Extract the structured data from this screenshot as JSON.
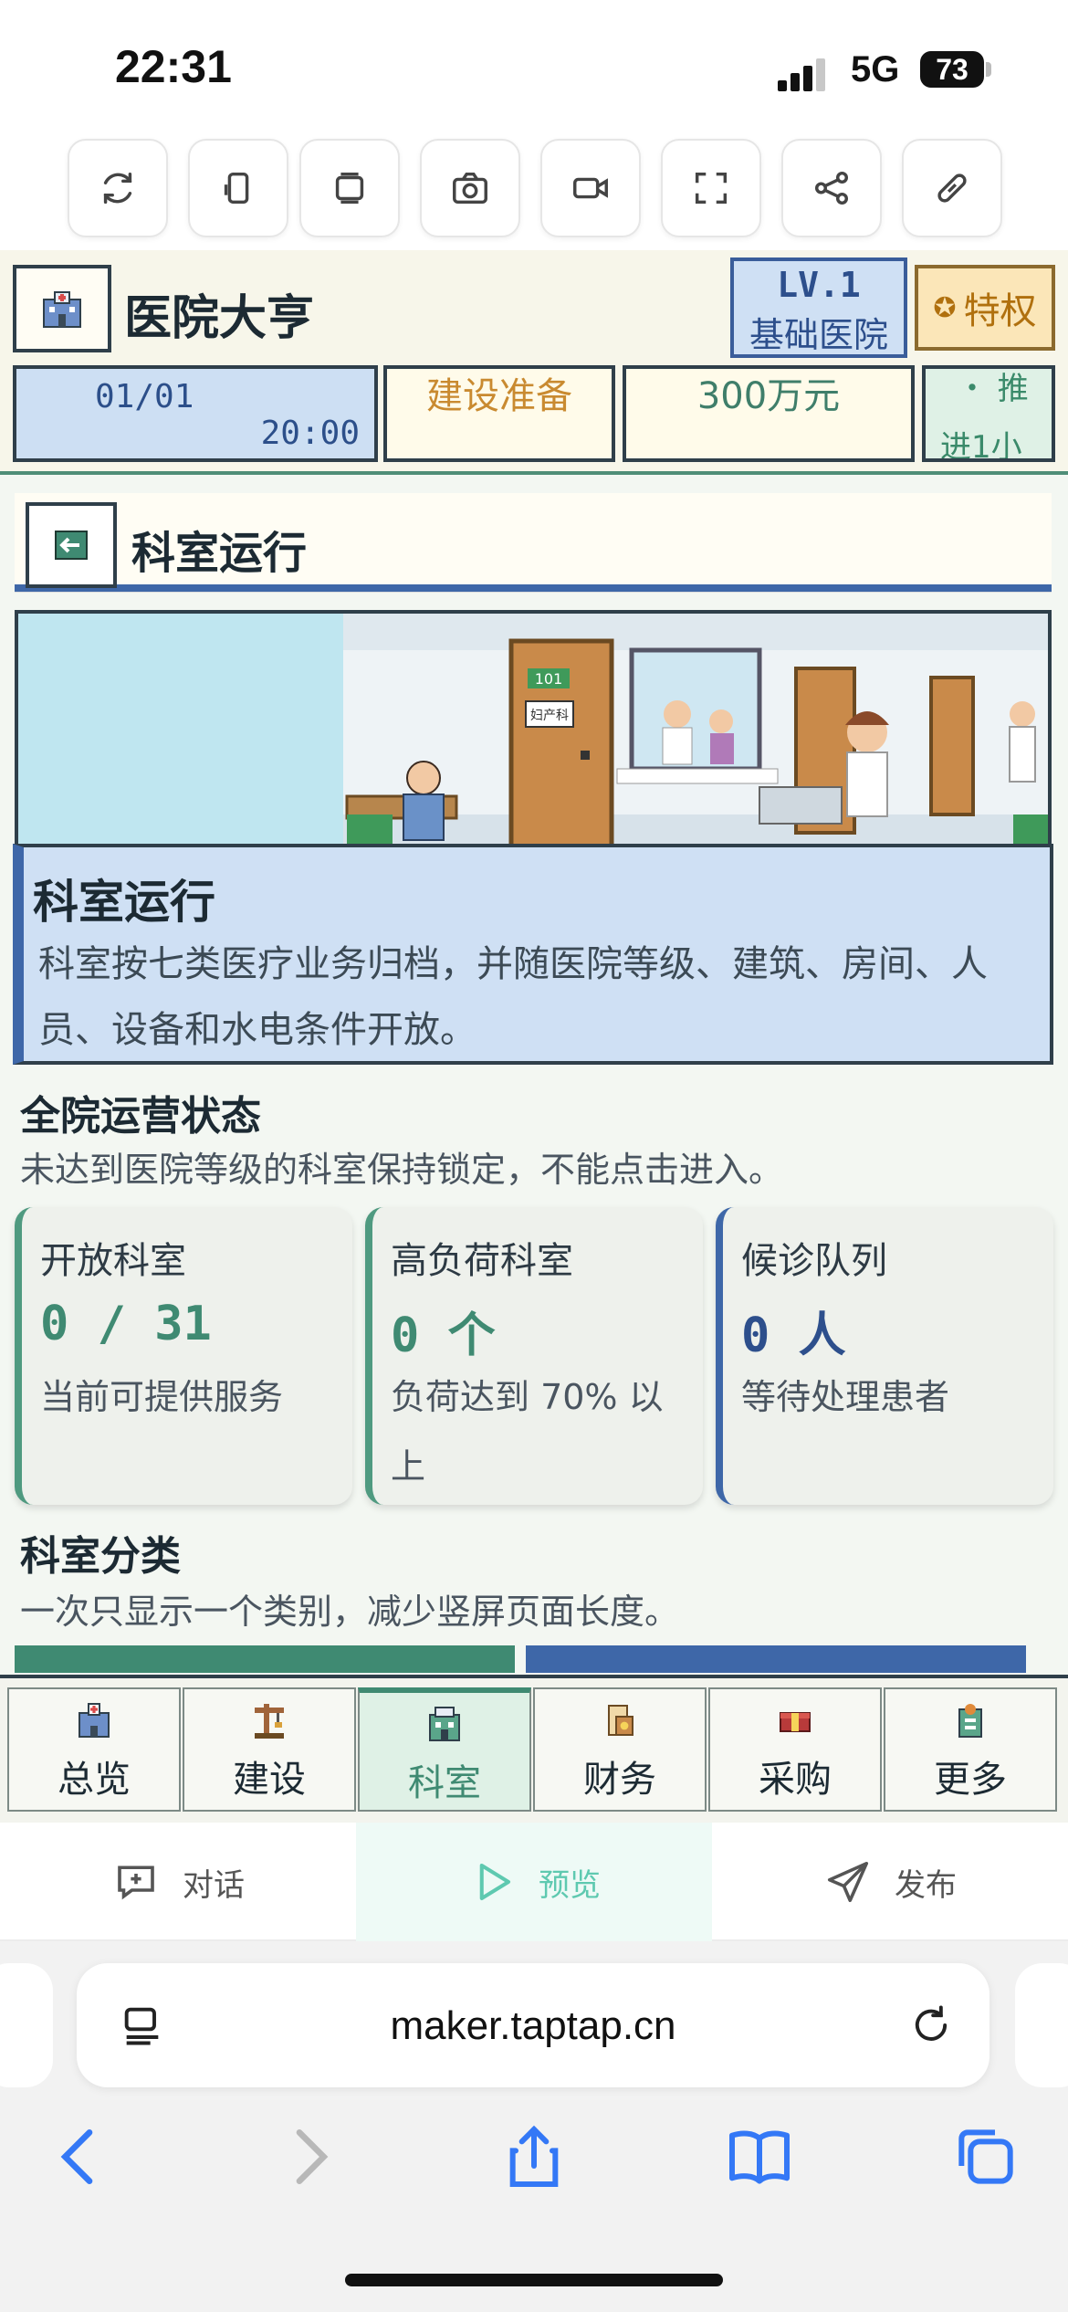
{
  "status_bar": {
    "time": "22:31",
    "network": "5G",
    "battery": "73"
  },
  "toolbar": {
    "icons": [
      "refresh-icon",
      "rotate-icon",
      "copy-icon",
      "screenshot-icon",
      "record-icon",
      "fullscreen-icon",
      "share-icon",
      "link-icon"
    ]
  },
  "game": {
    "header": {
      "title": "医院大亨",
      "level": "LV.1",
      "level_name": "基础医院",
      "privilege": "特权",
      "date": "01/01",
      "time": "20:00",
      "phase": "建设准备",
      "money": "300万元",
      "tip_line1": "・ 推",
      "tip_line2": "进1小"
    },
    "section": {
      "title": "科室运行"
    },
    "banner": {
      "door_label_101": "101",
      "door_label_obstetrics": "妇产科",
      "title": "科室运行",
      "description": "科室按七类医疗业务归档，并随医院等级、建筑、房间、人员、设备和水电条件开放。"
    },
    "overview": {
      "heading": "全院运营状态",
      "subtitle": "未达到医院等级的科室保持锁定，不能点击进入。",
      "cards": [
        {
          "label": "开放科室",
          "value": "0 / 31",
          "note": "当前可提供服务"
        },
        {
          "label": "高负荷科室",
          "value": "0 个",
          "note": "负荷达到 70% 以上"
        },
        {
          "label": "候诊队列",
          "value": "0 人",
          "note": "等待处理患者"
        }
      ]
    },
    "categories": {
      "heading": "科室分类",
      "subtitle": "一次只显示一个类别，减少竖屏页面长度。"
    },
    "bottom_nav": [
      {
        "label": "总览",
        "icon": "hospital-icon"
      },
      {
        "label": "建设",
        "icon": "crane-icon"
      },
      {
        "label": "科室",
        "icon": "department-icon",
        "active": true
      },
      {
        "label": "财务",
        "icon": "money-icon"
      },
      {
        "label": "采购",
        "icon": "box-icon"
      },
      {
        "label": "更多",
        "icon": "more-icon"
      }
    ]
  },
  "maker_bar": {
    "chat": "对话",
    "preview": "预览",
    "publish": "发布"
  },
  "browser": {
    "url": "maker.taptap.cn"
  },
  "colors": {
    "accent_green": "#3f8a72",
    "accent_blue": "#3e67a8",
    "preview_teal": "#5ec9b0"
  }
}
